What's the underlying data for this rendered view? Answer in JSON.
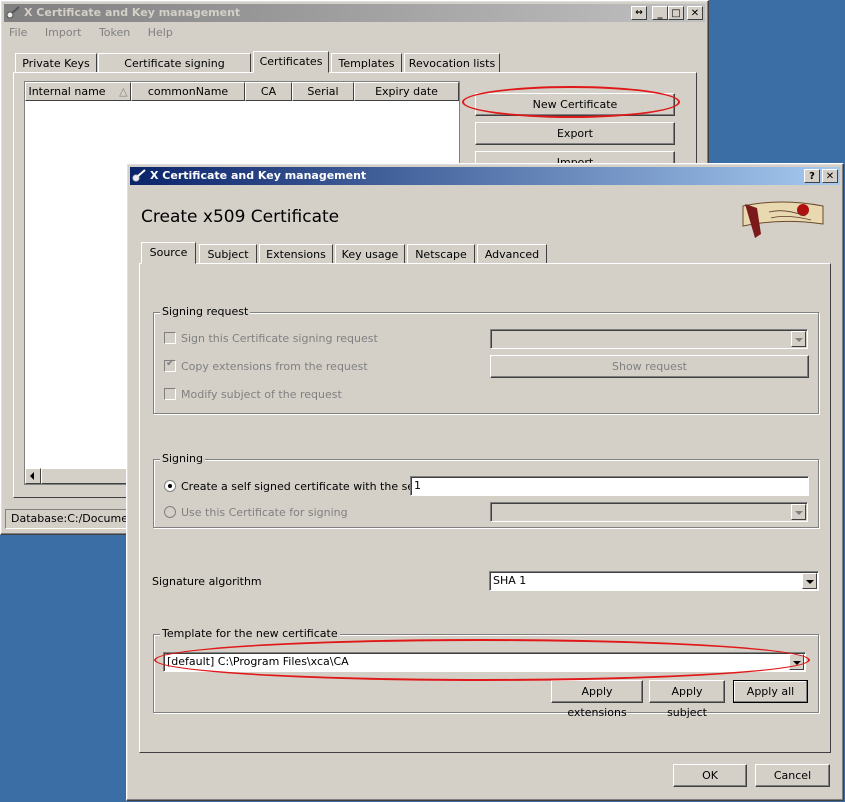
{
  "main_window": {
    "title": "X Certificate and Key management",
    "menu": [
      "File",
      "Import",
      "Token",
      "Help"
    ],
    "tabs": [
      "Private Keys",
      "Certificate signing requests",
      "Certificates",
      "Templates",
      "Revocation lists"
    ],
    "columns": [
      "Internal name",
      "commonName",
      "CA",
      "Serial",
      "Expiry date"
    ],
    "buttons": {
      "new_certificate": "New Certificate",
      "export": "Export",
      "import": "Import"
    },
    "status": "Database:C:/Documents"
  },
  "dialog": {
    "title": "X Certificate and Key management",
    "heading": "Create x509 Certificate",
    "tabs": [
      "Source",
      "Subject",
      "Extensions",
      "Key usage",
      "Netscape",
      "Advanced"
    ],
    "signing_request": {
      "group_label": "Signing request",
      "sign_csr": "Sign this Certificate signing request",
      "copy_extensions": "Copy extensions from the request",
      "modify_subject": "Modify subject of the request",
      "show_request": "Show request"
    },
    "signing": {
      "group_label": "Signing",
      "self_signed": "Create a self signed certificate with the serial",
      "serial_value": "1",
      "use_cert": "Use this Certificate for signing"
    },
    "signature_algorithm": {
      "label": "Signature algorithm",
      "value": "SHA 1"
    },
    "template": {
      "group_label": "Template for the new certificate",
      "value": "[default] C:\\Program Files\\xca\\CA",
      "apply_extensions": "Apply extensions",
      "apply_subject": "Apply subject",
      "apply_all": "Apply all"
    },
    "ok": "OK",
    "cancel": "Cancel"
  },
  "colors": {
    "desktop": "#3a6ea5",
    "highlight_ring": "#e01818",
    "active_title": "#0a246a"
  }
}
